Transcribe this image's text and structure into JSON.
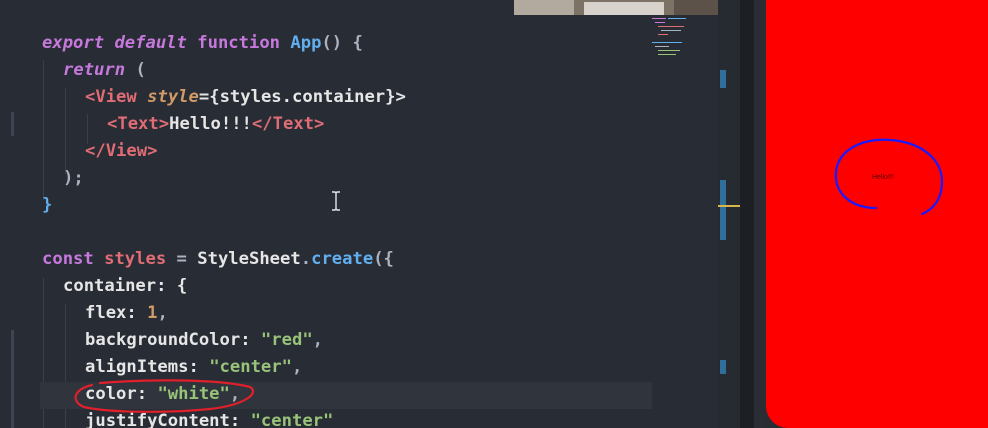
{
  "editor": {
    "code_lines": [
      [
        "export default function App() {"
      ],
      [
        "return ("
      ],
      [
        "<View style={styles.container}>"
      ],
      [
        "<Text>Hello!!!</Text>"
      ],
      [
        "</View>"
      ],
      [
        ");"
      ],
      [
        "}"
      ],
      [
        ""
      ],
      [
        "const styles = StyleSheet.create({"
      ],
      [
        "container: {"
      ],
      [
        "flex: 1,"
      ],
      [
        "backgroundColor: \"red\","
      ],
      [
        "alignItems: \"center\","
      ],
      [
        "color: \"white\","
      ],
      [
        "justifyContent: \"center\""
      ]
    ],
    "tokens": {
      "l1_export": "export",
      "l1_default": "default",
      "l1_function": "function",
      "l1_name": "App",
      "l1_rest": "() {",
      "l2_return": "return",
      "l2_paren": "(",
      "l3_open": "<",
      "l3_tag": "View",
      "l3_attr": "style",
      "l3_rest": "={styles.container}>",
      "l4_open": "<",
      "l4_tag": "Text",
      "l4_close1": ">",
      "l4_text": "Hello!!!",
      "l4_close_open": "</",
      "l4_tag2": "Text",
      "l4_close2": ">",
      "l5_open": "</",
      "l5_tag": "View",
      "l5_close": ">",
      "l6": ");",
      "l7": "}",
      "l9_const": "const",
      "l9_var": "styles",
      "l9_eq": " = ",
      "l9_class": "StyleSheet",
      "l9_dot": ".",
      "l9_fn": "create",
      "l9_rest": "({",
      "l10": "container: {",
      "l11_key": "flex: ",
      "l11_val": "1",
      "l11_end": ",",
      "l12_key": "backgroundColor: ",
      "l12_val": "\"red\"",
      "l12_end": ",",
      "l13_key": "alignItems: ",
      "l13_val": "\"center\"",
      "l13_end": ",",
      "l14_key": "color: ",
      "l14_val": "\"white\"",
      "l14_end": ",",
      "l15_key": "justifyContent: ",
      "l15_val": "\"center\""
    }
  },
  "simulator": {
    "hello_text": "Hello!!!",
    "background_color": "#ff0000"
  },
  "colors": {
    "editor_bg": "#282c34",
    "keyword": "#c678dd",
    "function": "#61afef",
    "tag": "#e06c75",
    "string": "#98c379",
    "number": "#d19a66",
    "annotation": "#e0202a",
    "circle": "#1a1aff",
    "scroll_cursor": "#d9b64a"
  }
}
